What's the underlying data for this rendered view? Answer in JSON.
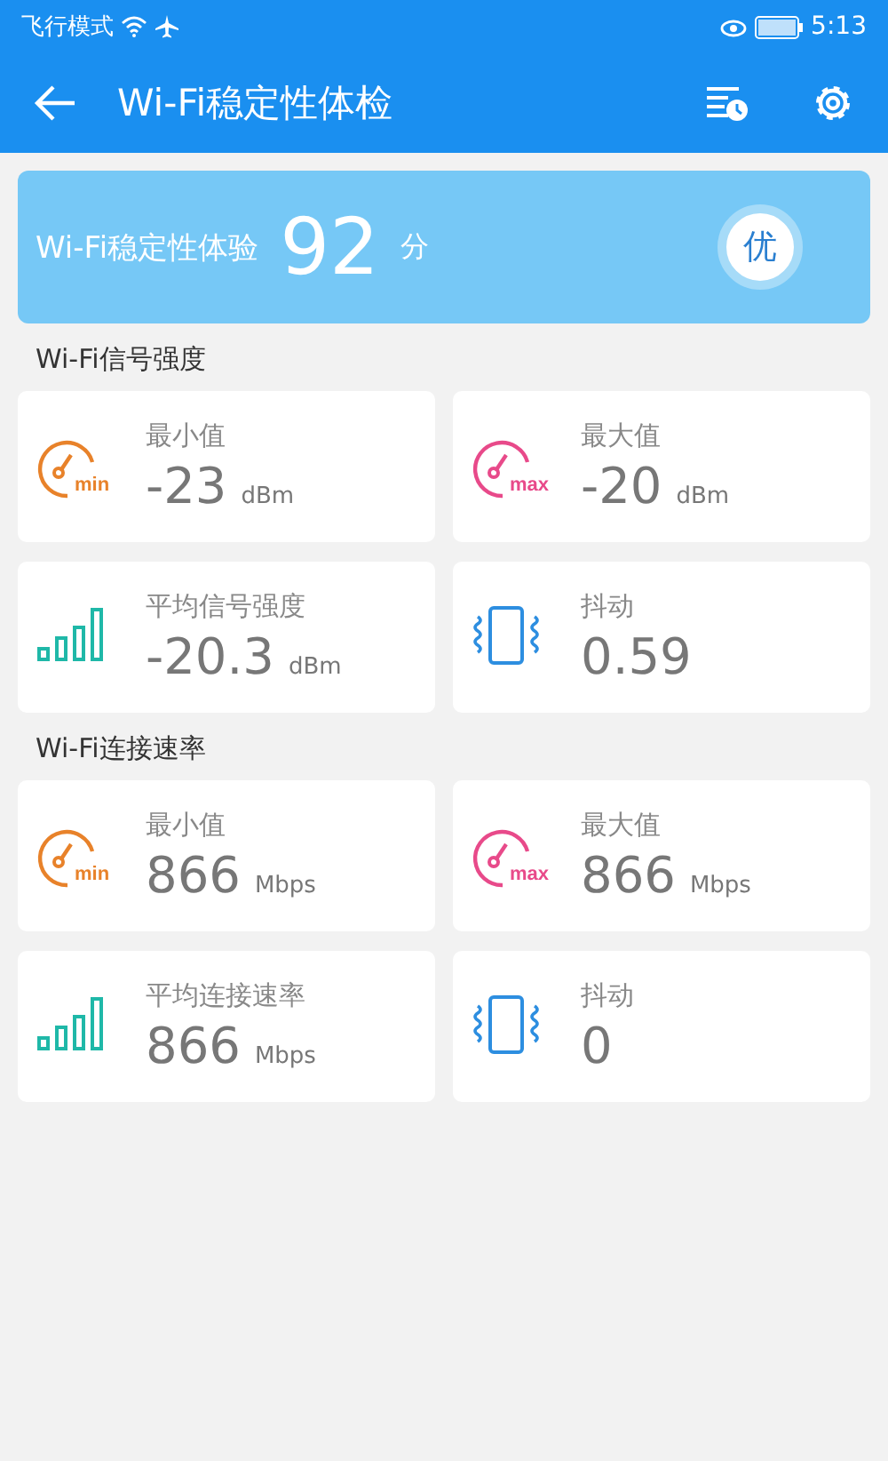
{
  "status_bar": {
    "carrier": "飞行模式",
    "time": "5:13"
  },
  "app_bar": {
    "title": "Wi-Fi稳定性体检"
  },
  "score": {
    "label": "Wi-Fi稳定性体验",
    "value": "92",
    "unit": "分",
    "grade": "优"
  },
  "sections": [
    {
      "title": "Wi-Fi信号强度",
      "stats": [
        {
          "kind": "min",
          "icon_text": "min",
          "label": "最小值",
          "value": "-23",
          "unit": "dBm"
        },
        {
          "kind": "max",
          "icon_text": "max",
          "label": "最大值",
          "value": "-20",
          "unit": "dBm"
        },
        {
          "kind": "bars",
          "label": "平均信号强度",
          "value": "-20.3",
          "unit": "dBm"
        },
        {
          "kind": "vibrate",
          "label": "抖动",
          "value": "0.59"
        }
      ]
    },
    {
      "title": "Wi-Fi连接速率",
      "stats": [
        {
          "kind": "min",
          "icon_text": "min",
          "label": "最小值",
          "value": "866",
          "unit": "Mbps"
        },
        {
          "kind": "max",
          "icon_text": "max",
          "label": "最大值",
          "value": "866",
          "unit": "Mbps"
        },
        {
          "kind": "bars",
          "label": "平均连接速率",
          "value": "866",
          "unit": "Mbps"
        },
        {
          "kind": "vibrate",
          "label": "抖动",
          "value": "0"
        }
      ]
    }
  ]
}
